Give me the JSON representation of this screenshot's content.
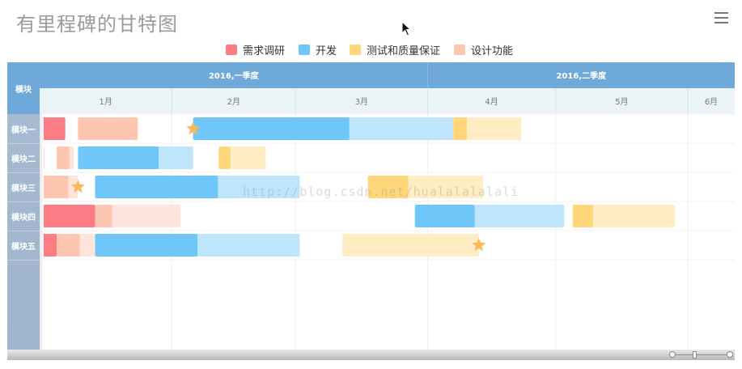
{
  "title": "有里程碑的甘特图",
  "watermark": "http://blog.csdn.net/hualalalalali",
  "colors": {
    "header_blue": "#6fa9d9",
    "subheader_bg": "#eaf3f5",
    "module_col": "#a3b7cf"
  },
  "chart_data": {
    "type": "gantt",
    "legend": [
      {
        "name": "需求调研",
        "color": "#fc7c86"
      },
      {
        "name": "开发",
        "color": "#6ec6f9"
      },
      {
        "name": "测试和质量保证",
        "color": "#ffd77a"
      },
      {
        "name": "设计功能",
        "color": "#fcc6b0"
      }
    ],
    "module_header": "模块",
    "modules": [
      "模块一",
      "模块二",
      "模块三",
      "模块四",
      "模块五"
    ],
    "quarters": [
      "2016,一季度",
      "2016,二季度"
    ],
    "months": [
      "1月",
      "2月",
      "3月",
      "4月",
      "5月",
      "6月"
    ],
    "x_range": [
      "2016-01-01",
      "2016-06-12"
    ],
    "tasks": [
      {
        "module": "模块一",
        "category": "需求调研",
        "start": "2016-01-01",
        "end": "2016-01-07",
        "progress": 1.0
      },
      {
        "module": "模块一",
        "category": "设计功能",
        "start": "2016-01-10",
        "end": "2016-01-24",
        "progress": 1.0
      },
      {
        "module": "模块一",
        "category": "开发",
        "start": "2016-02-06",
        "end": "2016-04-07",
        "progress": 0.6
      },
      {
        "module": "模块一",
        "category": "测试和质量保证",
        "start": "2016-04-07",
        "end": "2016-04-23",
        "progress": 0.2
      },
      {
        "module": "模块二",
        "category": "需求调研",
        "start": "2016-01-01",
        "end": "2016-01-02",
        "progress": 1.0
      },
      {
        "module": "模块二",
        "category": "设计功能",
        "start": "2016-01-05",
        "end": "2016-01-09",
        "progress": 0.75
      },
      {
        "module": "模块二",
        "category": "开发",
        "start": "2016-01-10",
        "end": "2016-02-06",
        "progress": 0.7
      },
      {
        "module": "模块二",
        "category": "测试和质量保证",
        "start": "2016-02-12",
        "end": "2016-02-23",
        "progress": 0.25
      },
      {
        "module": "模块三",
        "category": "设计功能",
        "start": "2016-01-01",
        "end": "2016-01-10",
        "progress": 0.75
      },
      {
        "module": "模块三",
        "category": "开发",
        "start": "2016-01-14",
        "end": "2016-03-02",
        "progress": 0.6
      },
      {
        "module": "模块三",
        "category": "测试和质量保证",
        "start": "2016-03-18",
        "end": "2016-04-14",
        "progress": 0.35
      },
      {
        "module": "模块四",
        "category": "需求调研",
        "start": "2016-01-01",
        "end": "2016-01-14",
        "progress": 1.0
      },
      {
        "module": "模块四",
        "category": "设计功能",
        "start": "2016-01-14",
        "end": "2016-02-03",
        "progress": 0.2
      },
      {
        "module": "模块四",
        "category": "开发",
        "start": "2016-03-29",
        "end": "2016-05-03",
        "progress": 0.4
      },
      {
        "module": "模块四",
        "category": "测试和质量保证",
        "start": "2016-05-05",
        "end": "2016-05-29",
        "progress": 0.2
      },
      {
        "module": "模块五",
        "category": "需求调研",
        "start": "2016-01-01",
        "end": "2016-01-05",
        "progress": 1.0
      },
      {
        "module": "模块五",
        "category": "设计功能",
        "start": "2016-01-05",
        "end": "2016-01-14",
        "progress": 0.6
      },
      {
        "module": "模块五",
        "category": "开发",
        "start": "2016-01-14",
        "end": "2016-03-02",
        "progress": 0.5
      },
      {
        "module": "模块五",
        "category": "测试和质量保证",
        "start": "2016-03-12",
        "end": "2016-04-13",
        "progress": 0.0
      }
    ],
    "milestones": [
      {
        "module": "模块一",
        "date": "2016-02-06",
        "color": "#f9b95c"
      },
      {
        "module": "模块三",
        "date": "2016-01-10",
        "color": "#f9b95c"
      },
      {
        "module": "模块五",
        "date": "2016-04-13",
        "color": "#f9b95c"
      }
    ]
  }
}
